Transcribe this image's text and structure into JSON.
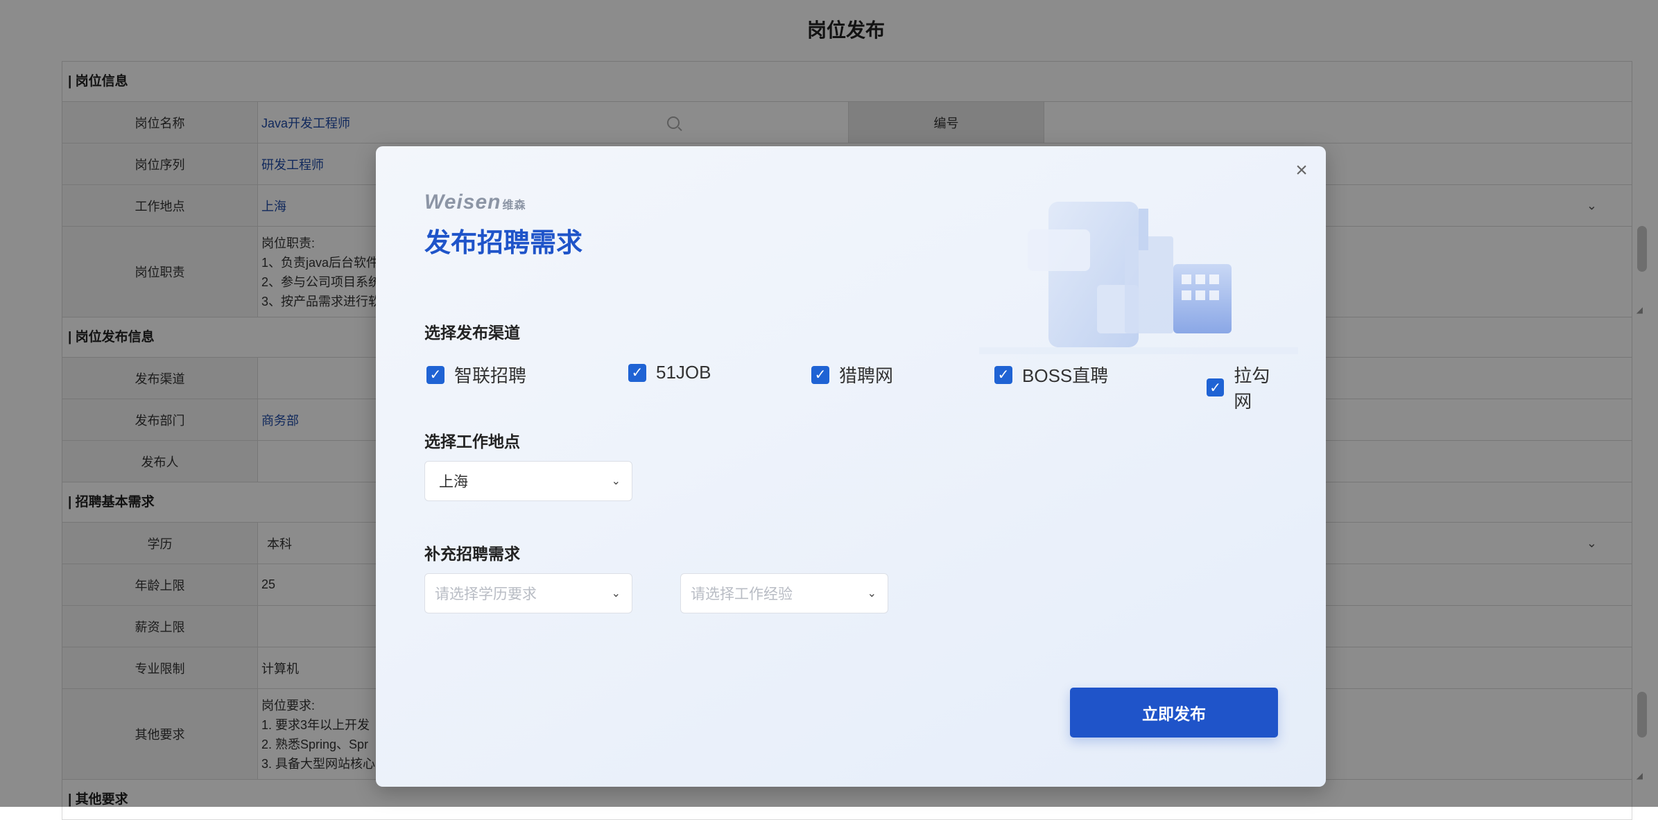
{
  "page": {
    "title": "岗位发布"
  },
  "form": {
    "sections": {
      "info": "| 岗位信息",
      "publish": "| 岗位发布信息",
      "basic": "| 招聘基本需求",
      "other": "| 其他要求"
    },
    "info": {
      "name_label": "岗位名称",
      "name_value": "Java开发工程师",
      "code_label": "编号",
      "seq_label": "岗位序列",
      "seq_value": "研发工程师",
      "location_label": "工作地点",
      "location_value": "上海",
      "duty_label": "岗位职责",
      "duty_value": "岗位职责:\n1、负责java后台软件\n2、参与公司项目系统\n3、按产品需求进行软"
    },
    "publish": {
      "channel_label": "发布渠道",
      "dept_label": "发布部门",
      "dept_value": "商务部",
      "publisher_label": "发布人"
    },
    "basic": {
      "edu_label": "学历",
      "edu_value": "本科",
      "age_label": "年龄上限",
      "age_value": "25",
      "salary_label": "薪资上限",
      "major_label": "专业限制",
      "major_value": "计算机",
      "other_label": "其他要求",
      "other_value": "岗位要求:\n1. 要求3年以上开发\n2. 熟悉Spring、Spr\n3. 具备大型网站核心"
    }
  },
  "modal": {
    "brand": "Weisen",
    "brand_cn": "维森",
    "title": "发布招聘需求",
    "channel_section": "选择发布渠道",
    "channels": [
      {
        "label": "智联招聘",
        "checked": true
      },
      {
        "label": "51JOB",
        "checked": true
      },
      {
        "label": "猎聘网",
        "checked": true
      },
      {
        "label": "BOSS直聘",
        "checked": true
      },
      {
        "label": "拉勾网",
        "checked": true
      }
    ],
    "location_section": "选择工作地点",
    "location_value": "上海",
    "extra_section": "补充招聘需求",
    "edu_placeholder": "请选择学历要求",
    "exp_placeholder": "请选择工作经验",
    "submit_label": "立即发布"
  },
  "colors": {
    "accent": "#1f54c9",
    "checkbox": "#1f63d4"
  }
}
